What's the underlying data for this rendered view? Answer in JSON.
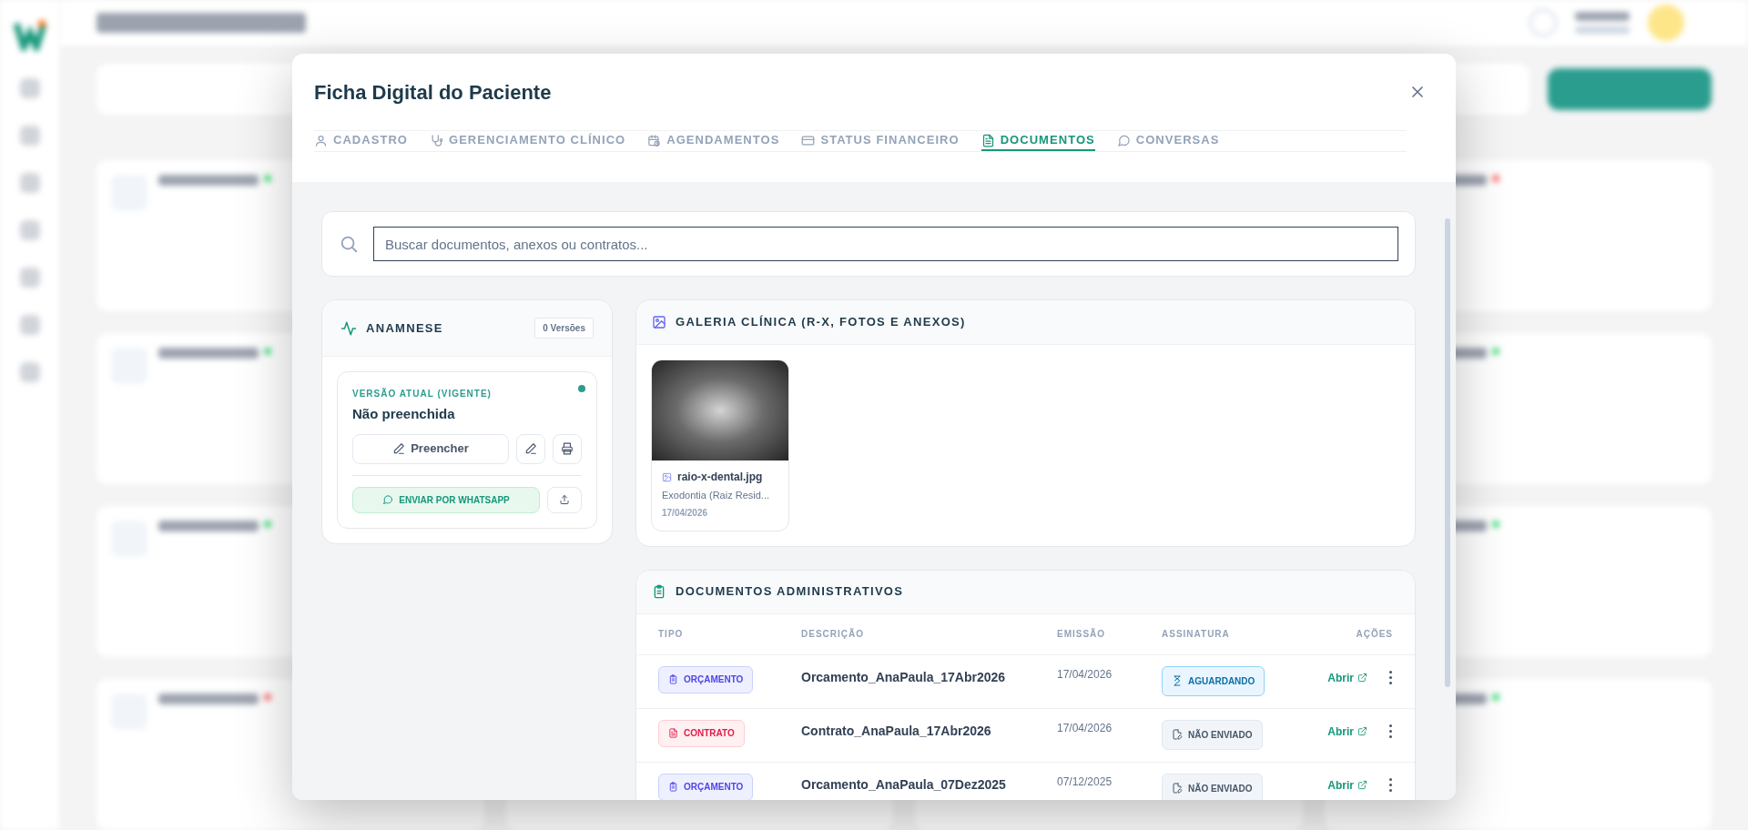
{
  "modal": {
    "title": "Ficha Digital do Paciente",
    "tabs": [
      {
        "label": "CADASTRO",
        "selected": false
      },
      {
        "label": "GERENCIAMENTO CLÍNICO",
        "selected": false
      },
      {
        "label": "AGENDAMENTOS",
        "selected": false
      },
      {
        "label": "STATUS FINANCEIRO",
        "selected": false
      },
      {
        "label": "DOCUMENTOS",
        "selected": true
      },
      {
        "label": "CONVERSAS",
        "selected": false
      }
    ],
    "search": {
      "placeholder": "Buscar documentos, anexos ou contratos..."
    },
    "anamnese": {
      "title": "ANAMNESE",
      "versions": "0 Versões",
      "version_label": "VERSÃO ATUAL (VIGENTE)",
      "active": true,
      "status": "Não preenchida",
      "fill_button": "Preencher",
      "whatsapp_button": "ENVIAR POR WHATSAPP"
    },
    "gallery": {
      "title": "GALERIA CLÍNICA (R-X, FOTOS E ANEXOS)",
      "items": [
        {
          "filename": "raio-x-dental.jpg",
          "description": "Exodontia (Raiz Resid...",
          "date": "17/04/2026"
        }
      ]
    },
    "documents": {
      "title": "DOCUMENTOS ADMINISTRATIVOS",
      "columns": [
        "TIPO",
        "DESCRIÇÃO",
        "EMISSÃO",
        "ASSINATURA",
        "AÇÕES"
      ],
      "rows": [
        {
          "type": {
            "kind": "budget",
            "label": "ORÇAMENTO"
          },
          "description": "Orcamento_AnaPaula_17Abr2026",
          "date": "17/04/2026",
          "signature": {
            "kind": "waiting",
            "label": "AGUARDANDO"
          },
          "action": "Abrir"
        },
        {
          "type": {
            "kind": "contract",
            "label": "CONTRATO"
          },
          "description": "Contrato_AnaPaula_17Abr2026",
          "date": "17/04/2026",
          "signature": {
            "kind": "not_sent",
            "label": "NÃO ENVIADO"
          },
          "action": "Abrir"
        },
        {
          "type": {
            "kind": "budget",
            "label": "ORÇAMENTO"
          },
          "description": "Orcamento_AnaPaula_07Dez2025",
          "date": "07/12/2025",
          "signature": {
            "kind": "not_sent",
            "label": "NÃO ENVIADO"
          },
          "action": "Abrir"
        }
      ]
    }
  }
}
